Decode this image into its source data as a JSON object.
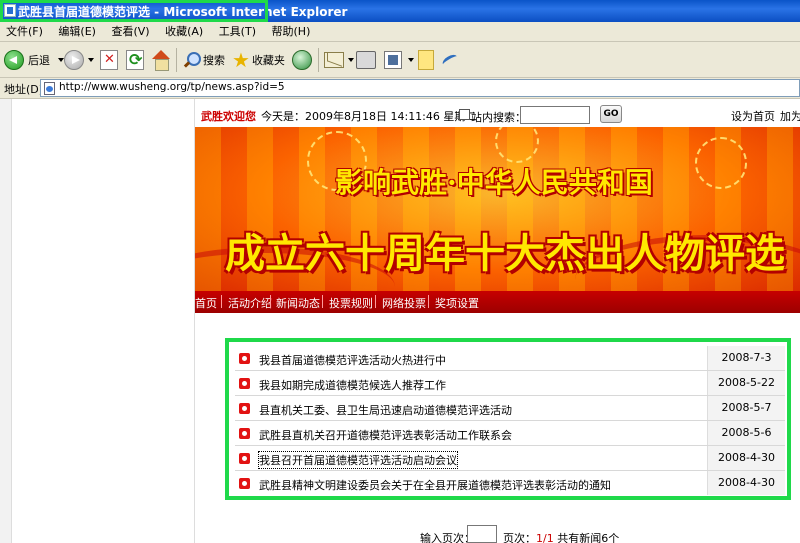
{
  "window": {
    "title": "武胜县首届道德模范评选 - Microsoft Internet Explorer"
  },
  "menu": [
    "文件(F)",
    "编辑(E)",
    "查看(V)",
    "收藏(A)",
    "工具(T)",
    "帮助(H)"
  ],
  "toolbar": {
    "back_label": "后退",
    "search_label": "搜索",
    "favorites_label": "收藏夹"
  },
  "address": {
    "label": "地址(D)",
    "url": "http://www.wusheng.org/tp/news.asp?id=5"
  },
  "site": {
    "welcome": "武胜欢迎您",
    "date_text": "今天是：2009年8月18日 14:11:46 星期二",
    "site_search_label": "站内搜索：",
    "go_label": "GO",
    "set_home": "设为首页",
    "add_favorite": "加为"
  },
  "banner": {
    "line1": "影响武胜·中华人民共和国",
    "line2": "成立六十周年十大杰出人物评选"
  },
  "nav": [
    "首页",
    "活动介绍",
    "新闻动态",
    "投票规则",
    "网络投票",
    "奖项设置"
  ],
  "news": [
    {
      "title": "我县首届道德模范评选活动火热进行中",
      "date": "2008-7-3"
    },
    {
      "title": "我县如期完成道德模范候选人推荐工作",
      "date": "2008-5-22"
    },
    {
      "title": "县直机关工委、县卫生局迅速启动道德模范评选活动",
      "date": "2008-5-7"
    },
    {
      "title": "武胜县直机关召开道德模范评选表彰活动工作联系会",
      "date": "2008-5-6"
    },
    {
      "title": "我县召开首届道德模范评选活动启动会议",
      "date": "2008-4-30"
    },
    {
      "title": "武胜县精神文明建设委员会关于在全县开展道德模范评选表彰活动的通知",
      "date": "2008-4-30"
    }
  ],
  "pager": {
    "input_label": "输入页次：",
    "page_label": "页次：",
    "page_value": "1/1",
    "total_text": "共有新闻6个"
  },
  "colors": {
    "highlight_border": "#1fd94a",
    "nav_red": "#c70000",
    "banner_text": "#ffe800"
  }
}
